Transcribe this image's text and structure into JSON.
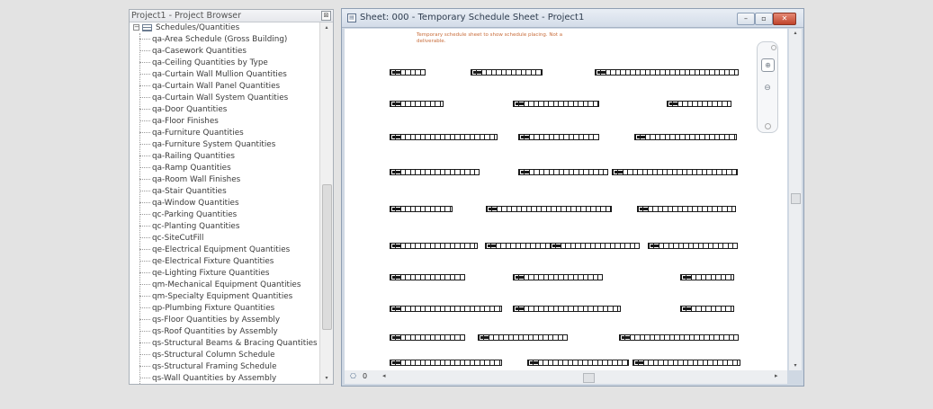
{
  "project_browser": {
    "title": "Project1 - Project Browser",
    "close_glyph": "⊠",
    "root": {
      "expander": "−",
      "label": "Schedules/Quantities"
    },
    "items": [
      "qa-Area Schedule (Gross Building)",
      "qa-Casework Quantities",
      "qa-Ceiling Quantities by Type",
      "qa-Curtain Wall Mullion Quantities",
      "qa-Curtain Wall Panel Quantities",
      "qa-Curtain Wall System Quantities",
      "qa-Door Quantities",
      "qa-Floor Finishes",
      "qa-Furniture Quantities",
      "qa-Furniture System Quantities",
      "qa-Railing Quantities",
      "qa-Ramp Quantities",
      "qa-Room Wall Finishes",
      "qa-Stair Quantities",
      "qa-Window Quantities",
      "qc-Parking Quantities",
      "qc-Planting Quantities",
      "qc-SiteCutFill",
      "qe-Electrical Equipment Quantities",
      "qe-Electrical Fixture Quantities",
      "qe-Lighting Fixture Quantities",
      "qm-Mechanical Equipment Quantities",
      "qm-Specialty Equipment Quantities",
      "qp-Plumbing Fixture Quantities",
      "qs-Floor Quantities by Assembly",
      "qs-Roof Quantities by Assembly",
      "qs-Structural Beams & Bracing Quantities",
      "qs-Structural Column Schedule",
      "qs-Structural Framing Schedule",
      "qs-Wall Quantities by Assembly"
    ]
  },
  "sheet_window": {
    "title": "Sheet: 000 - Temporary Schedule Sheet - Project1",
    "annotation": "Temporary schedule sheet to show schedule placing. Not a deliverable.",
    "buttons": {
      "minimize": "–",
      "restore": "▫",
      "close": "✕"
    },
    "scale_value": "0",
    "scale_glyph": "⎔",
    "scroll_left": "◂",
    "scroll_right": "▸",
    "scroll_up": "▴",
    "scroll_down": "▾"
  },
  "navigation": {
    "wheel_glyph": "⊕",
    "zoom_glyph": "⊖"
  }
}
